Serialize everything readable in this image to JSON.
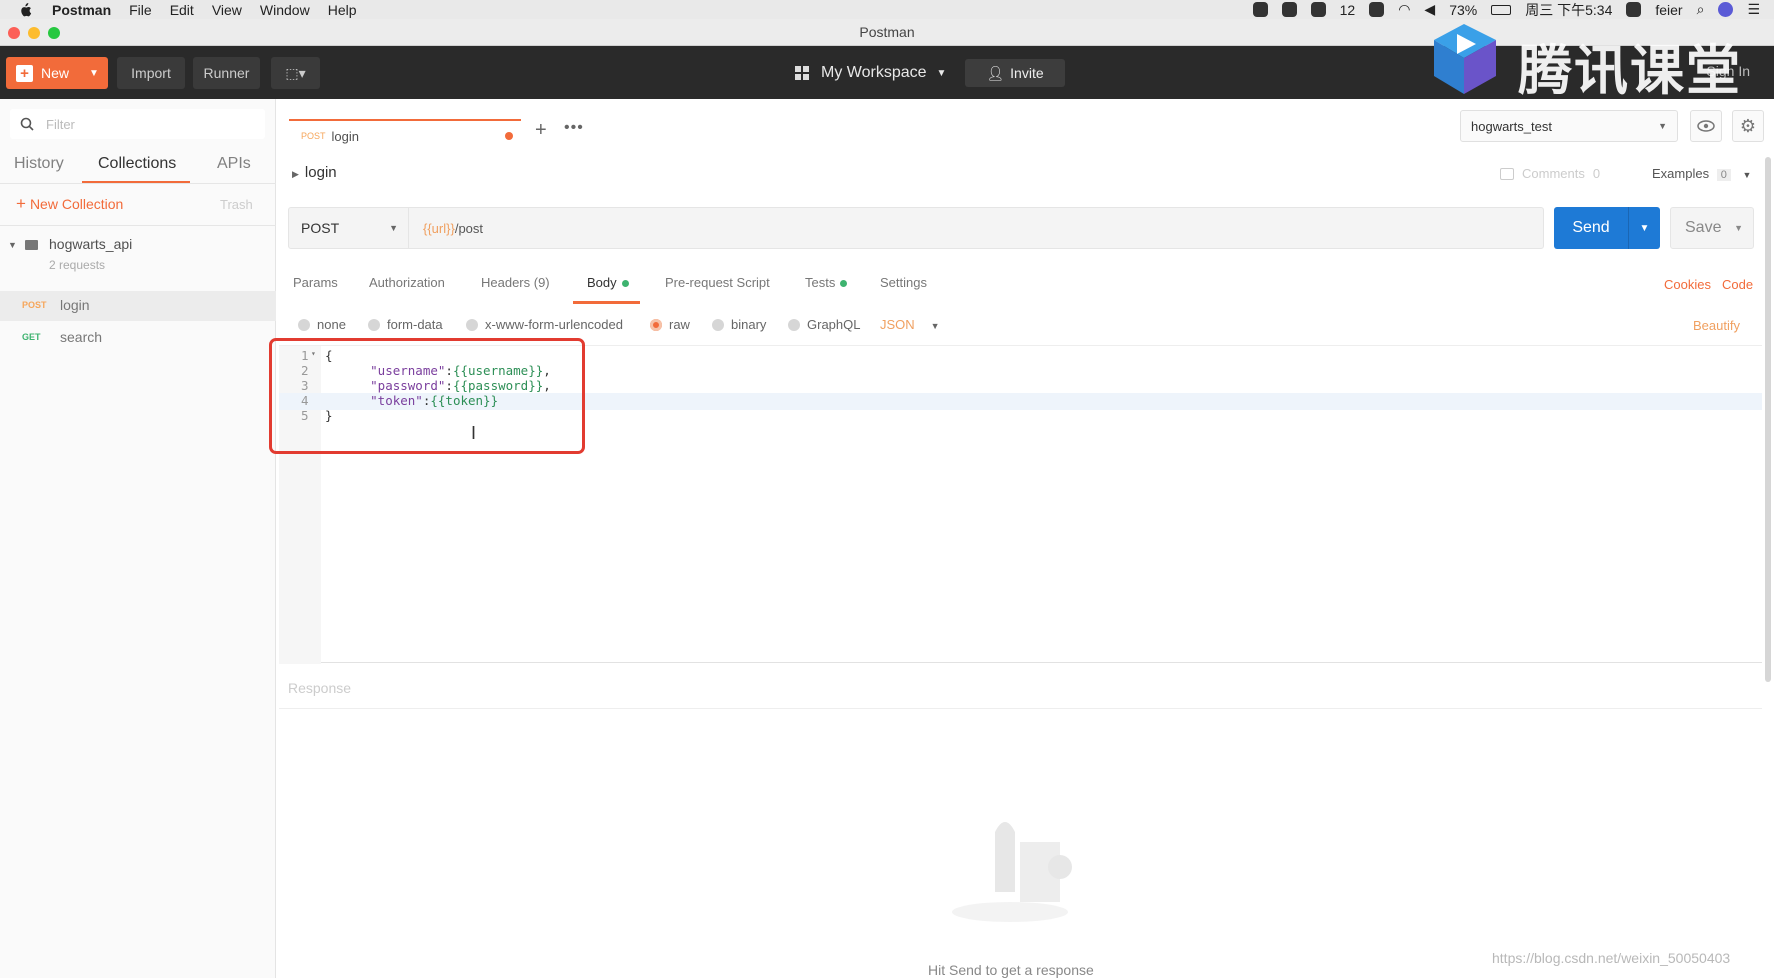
{
  "os_menu": {
    "app": "Postman",
    "items": [
      "File",
      "Edit",
      "View",
      "Window",
      "Help"
    ],
    "tray": {
      "notif_count": "12",
      "battery": "73%",
      "clock": "周三 下午5:34",
      "user": "feier"
    }
  },
  "window": {
    "title": "Postman"
  },
  "header": {
    "new_label": "New",
    "import_label": "Import",
    "runner_label": "Runner",
    "workspace_label": "My Workspace",
    "invite_label": "Invite",
    "signin_label": "Sign In"
  },
  "watermark": {
    "text": "腾讯课堂"
  },
  "sidebar": {
    "filter_placeholder": "Filter",
    "tabs": [
      "History",
      "Collections",
      "APIs"
    ],
    "active_tab": "Collections",
    "new_collection_label": "New Collection",
    "trash_label": "Trash",
    "collection": {
      "name": "hogwarts_api",
      "count": "2 requests"
    },
    "requests": [
      {
        "method": "POST",
        "name": "login",
        "active": true
      },
      {
        "method": "GET",
        "name": "search",
        "active": false
      }
    ]
  },
  "request_tab": {
    "method": "POST",
    "name": "login"
  },
  "environment": {
    "selected": "hogwarts_test"
  },
  "breadcrumb": {
    "name": "login"
  },
  "meta": {
    "comments_label": "Comments",
    "comments_count": "0",
    "examples_label": "Examples",
    "examples_count": "0"
  },
  "url_bar": {
    "method": "POST",
    "url_var": "{{url}}",
    "url_path": "/post"
  },
  "actions": {
    "send_label": "Send",
    "save_label": "Save"
  },
  "request_tabs": {
    "params": "Params",
    "authorization": "Authorization",
    "headers": "Headers (9)",
    "body": "Body",
    "prerequest": "Pre-request Script",
    "tests": "Tests",
    "settings": "Settings",
    "active": "Body",
    "cookies": "Cookies",
    "code": "Code"
  },
  "body_types": {
    "options": [
      "none",
      "form-data",
      "x-www-form-urlencoded",
      "raw",
      "binary",
      "GraphQL"
    ],
    "selected": "raw",
    "format": "JSON",
    "beautify": "Beautify"
  },
  "editor": {
    "lines": [
      {
        "n": "1",
        "text": "{"
      },
      {
        "n": "2",
        "key": "\"username\"",
        "value": "{{username}}",
        "suffix": ","
      },
      {
        "n": "3",
        "key": "\"password\"",
        "value": "{{password}}",
        "suffix": ","
      },
      {
        "n": "4",
        "key": "\"token\"",
        "value": "{{token}}",
        "suffix": ""
      },
      {
        "n": "5",
        "text": "}"
      }
    ]
  },
  "response": {
    "label": "Response",
    "empty_message": "Hit Send to get a response"
  },
  "footer_watermark": {
    "text": "https://blog.csdn.net/weixin_50050403"
  },
  "colors": {
    "accent": "#f26b3a",
    "send": "#1e7ad6",
    "header_bg": "#2a2a2a",
    "highlight_box": "#e23b30"
  }
}
